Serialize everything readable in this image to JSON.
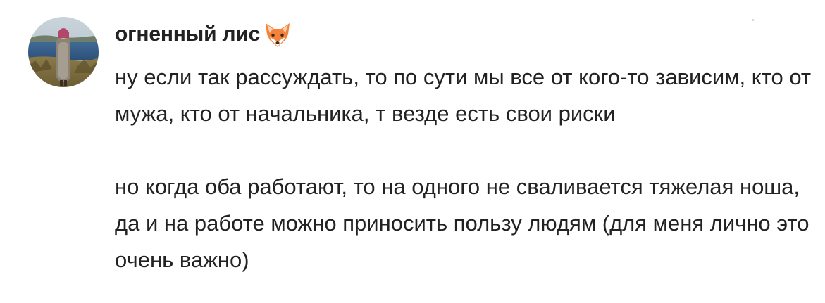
{
  "comment": {
    "author": {
      "name": "огненный лис",
      "emoji_icon": "fox-face-icon",
      "avatar_icon": "user-photo-avatar"
    },
    "paragraphs": [
      "ну если так рассуждать, то по сути мы все от кого-то зависим, кто от мужа, кто от начальника, т везде есть свои риски",
      "но когда оба работают, то на одного не сваливается тяжелая ноша, да и на работе можно приносить пользу людям (для меня лично это очень важно)"
    ]
  },
  "colors": {
    "text": "#222222",
    "background": "#ffffff",
    "fox_orange": "#f5813a"
  }
}
